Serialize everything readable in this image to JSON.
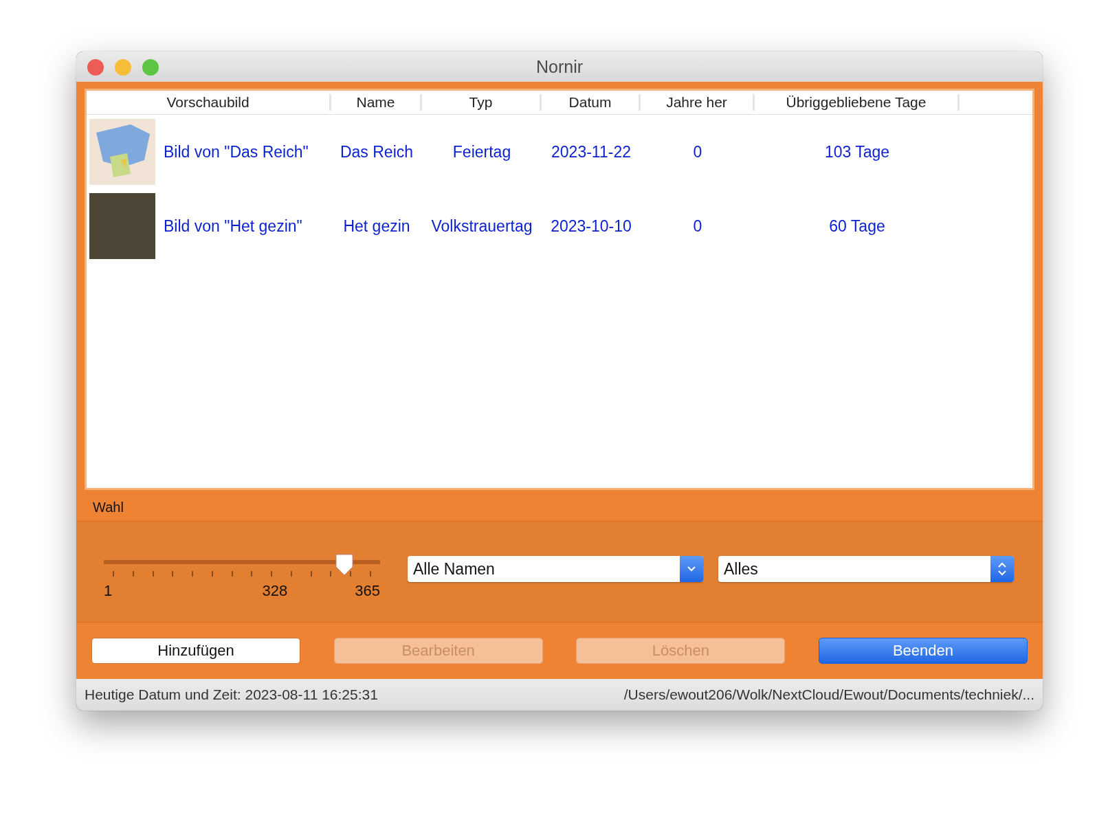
{
  "window": {
    "title": "Nornir"
  },
  "table": {
    "columns": [
      "Vorschaubild",
      "Name",
      "Typ",
      "Datum",
      "Jahre her",
      "Übriggebliebene Tage"
    ],
    "rows": [
      {
        "kind": "map",
        "preview": "Bild von \"Das Reich\"",
        "name": "Das Reich",
        "type": "Feiertag",
        "date": "2023-11-22",
        "years": "0",
        "days": "103 Tage"
      },
      {
        "kind": "photo",
        "preview": "Bild von \"Het gezin\"",
        "name": "Het gezin",
        "type": "Volkstrauertag",
        "date": "2023-10-10",
        "years": "0",
        "days": "60 Tage"
      }
    ]
  },
  "selection": {
    "label": "Wahl",
    "slider": {
      "level": 0.87,
      "ticks": [
        "1",
        "328",
        "365"
      ]
    },
    "name_dropdown": {
      "value": "Alle Namen"
    },
    "type_dropdown": {
      "value": "Alles"
    }
  },
  "buttons": [
    {
      "label": "Hinzufügen",
      "disabled": false,
      "default": false
    },
    {
      "label": "Bearbeiten",
      "disabled": true,
      "default": false
    },
    {
      "label": "Löschen",
      "disabled": true,
      "default": false
    },
    {
      "label": "Beenden",
      "disabled": false,
      "default": true
    }
  ],
  "status_bar": {
    "left": "Heutige Datum und Zeit: 2023-08-11 16:25:31",
    "right": "/Users/ewout206/Wolk/NextCloud/Ewout/Documents/techniek/..."
  }
}
